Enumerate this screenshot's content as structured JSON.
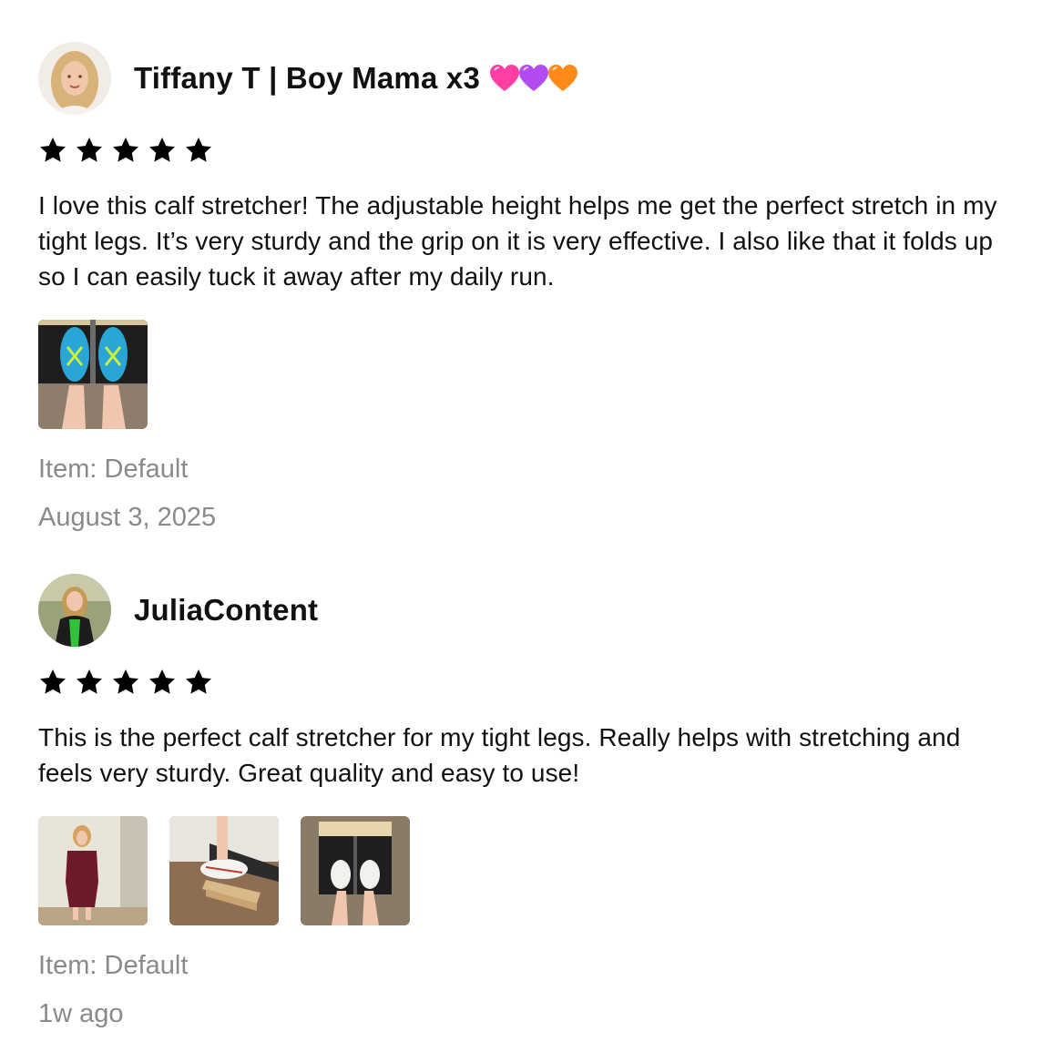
{
  "reviews": [
    {
      "username": "Tiffany T | Boy Mama x3",
      "username_emoji": [
        "pink-heart",
        "purple-heart",
        "orange-heart"
      ],
      "rating": 5,
      "text": "I love this calf stretcher! The adjustable height helps me get the perfect stretch in my tight legs. It’s very sturdy and the grip on it is very effective. I also like that it folds up so I can easily tuck it away after my daily run.",
      "item": "Item: Default",
      "date": "August 3, 2025",
      "photo_count": 1
    },
    {
      "username": "JuliaContent",
      "rating": 5,
      "text": "This is the perfect calf stretcher for my tight legs. Really helps with stretching and feels very sturdy. Great quality and easy to use!",
      "item": "Item: Default",
      "date": "1w ago",
      "photo_count": 3
    }
  ],
  "colors": {
    "text": "#111111",
    "meta": "#8a8a8a",
    "star": "#000000",
    "heart_pink": "#ff3fa4",
    "heart_purple": "#b24cf0",
    "heart_orange": "#ff8a1a"
  }
}
